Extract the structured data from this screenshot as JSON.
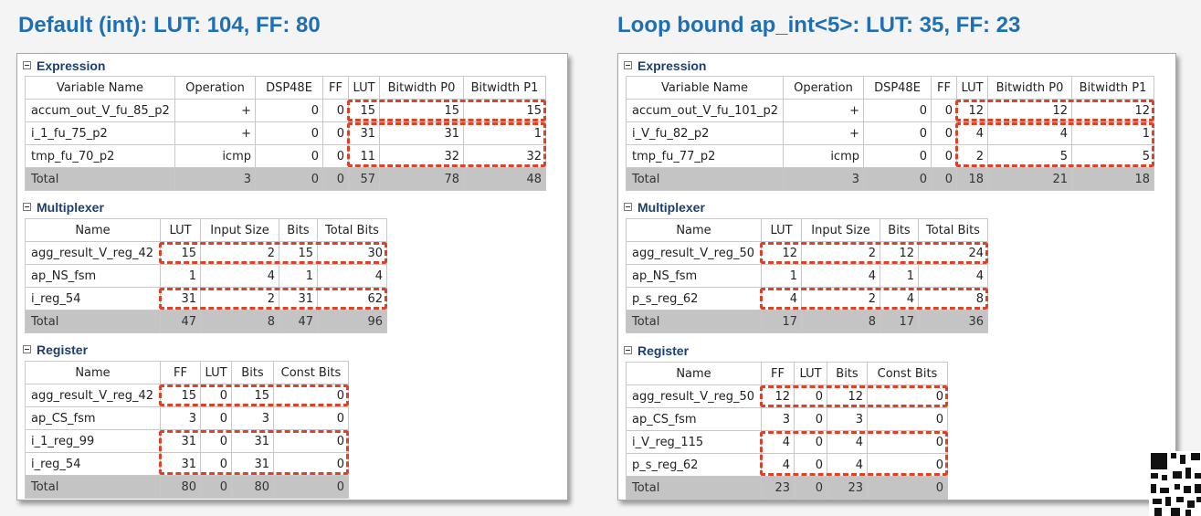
{
  "headings": {
    "left": "Default (int): LUT: 104, FF: 80",
    "right": "Loop bound ap_int<5>: LUT: 35, FF: 23"
  },
  "left": {
    "expression": {
      "title": "Expression",
      "columns": [
        "Variable Name",
        "Operation",
        "DSP48E",
        "FF",
        "LUT",
        "Bitwidth P0",
        "Bitwidth P1"
      ],
      "rows": [
        [
          "accum_out_V_fu_85_p2",
          "+",
          "0",
          "0",
          "15",
          "15",
          "15"
        ],
        [
          "i_1_fu_75_p2",
          "+",
          "0",
          "0",
          "31",
          "31",
          "1"
        ],
        [
          "tmp_fu_70_p2",
          "icmp",
          "0",
          "0",
          "11",
          "32",
          "32"
        ]
      ],
      "total": [
        "Total",
        "3",
        "0",
        "0",
        "57",
        "78",
        "48"
      ]
    },
    "multiplexer": {
      "title": "Multiplexer",
      "columns": [
        "Name",
        "LUT",
        "Input Size",
        "Bits",
        "Total Bits"
      ],
      "rows": [
        [
          "agg_result_V_reg_42",
          "15",
          "2",
          "15",
          "30"
        ],
        [
          "ap_NS_fsm",
          "1",
          "4",
          "1",
          "4"
        ],
        [
          "i_reg_54",
          "31",
          "2",
          "31",
          "62"
        ]
      ],
      "total": [
        "Total",
        "47",
        "8",
        "47",
        "96"
      ]
    },
    "register": {
      "title": "Register",
      "columns": [
        "Name",
        "FF",
        "LUT",
        "Bits",
        "Const Bits"
      ],
      "rows": [
        [
          "agg_result_V_reg_42",
          "15",
          "0",
          "15",
          "0"
        ],
        [
          "ap_CS_fsm",
          "3",
          "0",
          "3",
          "0"
        ],
        [
          "i_1_reg_99",
          "31",
          "0",
          "31",
          "0"
        ],
        [
          "i_reg_54",
          "31",
          "0",
          "31",
          "0"
        ]
      ],
      "total": [
        "Total",
        "80",
        "0",
        "80",
        "0"
      ]
    }
  },
  "right": {
    "expression": {
      "title": "Expression",
      "columns": [
        "Variable Name",
        "Operation",
        "DSP48E",
        "FF",
        "LUT",
        "Bitwidth P0",
        "Bitwidth P1"
      ],
      "rows": [
        [
          "accum_out_V_fu_101_p2",
          "+",
          "0",
          "0",
          "12",
          "12",
          "12"
        ],
        [
          "i_V_fu_82_p2",
          "+",
          "0",
          "0",
          "4",
          "4",
          "1"
        ],
        [
          "tmp_fu_77_p2",
          "icmp",
          "0",
          "0",
          "2",
          "5",
          "5"
        ]
      ],
      "total": [
        "Total",
        "3",
        "0",
        "0",
        "18",
        "21",
        "18"
      ]
    },
    "multiplexer": {
      "title": "Multiplexer",
      "columns": [
        "Name",
        "LUT",
        "Input Size",
        "Bits",
        "Total Bits"
      ],
      "rows": [
        [
          "agg_result_V_reg_50",
          "12",
          "2",
          "12",
          "24"
        ],
        [
          "ap_NS_fsm",
          "1",
          "4",
          "1",
          "4"
        ],
        [
          "p_s_reg_62",
          "4",
          "2",
          "4",
          "8"
        ]
      ],
      "total": [
        "Total",
        "17",
        "8",
        "17",
        "36"
      ]
    },
    "register": {
      "title": "Register",
      "columns": [
        "Name",
        "FF",
        "LUT",
        "Bits",
        "Const Bits"
      ],
      "rows": [
        [
          "agg_result_V_reg_50",
          "12",
          "0",
          "12",
          "0"
        ],
        [
          "ap_CS_fsm",
          "3",
          "0",
          "3",
          "0"
        ],
        [
          "i_V_reg_115",
          "4",
          "0",
          "4",
          "0"
        ],
        [
          "p_s_reg_62",
          "4",
          "0",
          "4",
          "0"
        ]
      ],
      "total": [
        "Total",
        "23",
        "0",
        "23",
        "0"
      ]
    }
  },
  "colors": {
    "heading": "#1f6fb4",
    "section_title": "#1d3f6e",
    "highlight": "#d9432a",
    "total_row": "#c4c4c4"
  },
  "icons": {
    "section_toggle": "collapse-icon",
    "corner": "qr-code-icon"
  }
}
